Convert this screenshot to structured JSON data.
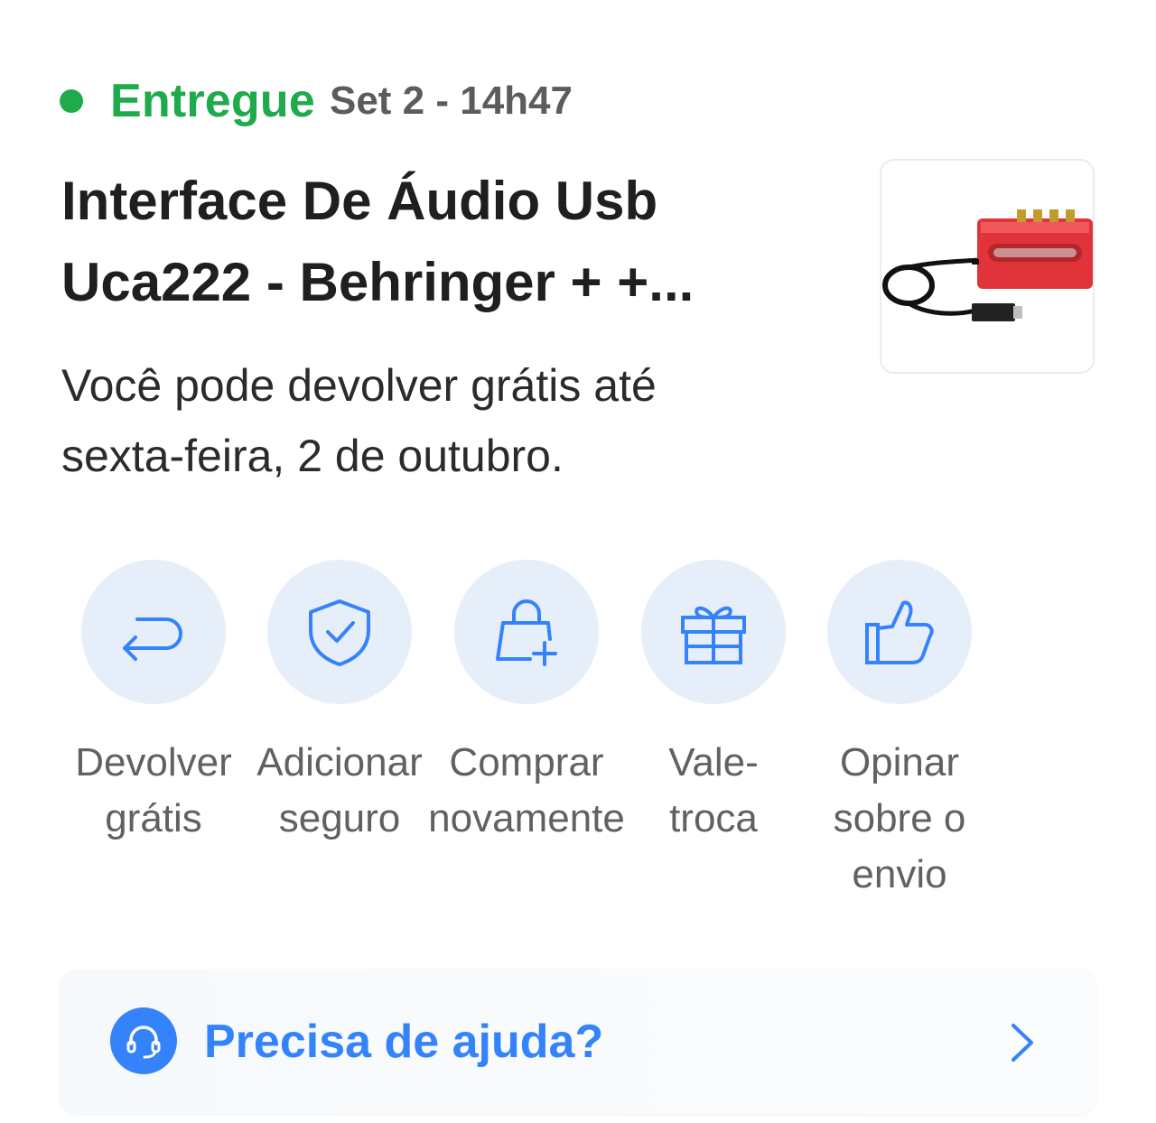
{
  "order": {
    "status": "Entregue",
    "status_time": "Set 2 - 14h47",
    "status_color": "#1faa4b",
    "title_lines": [
      "Interface De Áudio Usb",
      "Uca222 - Behringer + +..."
    ],
    "return_note_lines": [
      "Você pode devolver grátis até",
      "sexta-feira, 2 de outubro."
    ],
    "thumbnail": "product-photo-red-usb-audio-interface"
  },
  "actions": [
    {
      "icon": "return-arrow-icon",
      "label_lines": [
        "Devolver",
        "grátis"
      ]
    },
    {
      "icon": "shield-check-icon",
      "label_lines": [
        "Adicionar",
        "seguro"
      ]
    },
    {
      "icon": "shopping-bag-plus-icon",
      "label_lines": [
        "Comprar",
        "novamente"
      ]
    },
    {
      "icon": "gift-icon",
      "label_lines": [
        "Vale-",
        "troca"
      ]
    },
    {
      "icon": "thumbs-up-icon",
      "label_lines": [
        "Opinar",
        "sobre o",
        "envio"
      ]
    }
  ],
  "help": {
    "label": "Precisa de ajuda?",
    "icon": "headset-icon",
    "accent": "#3483fa"
  },
  "colors": {
    "action_bg": "#e6eefa",
    "icon_blue": "#3483fa"
  }
}
